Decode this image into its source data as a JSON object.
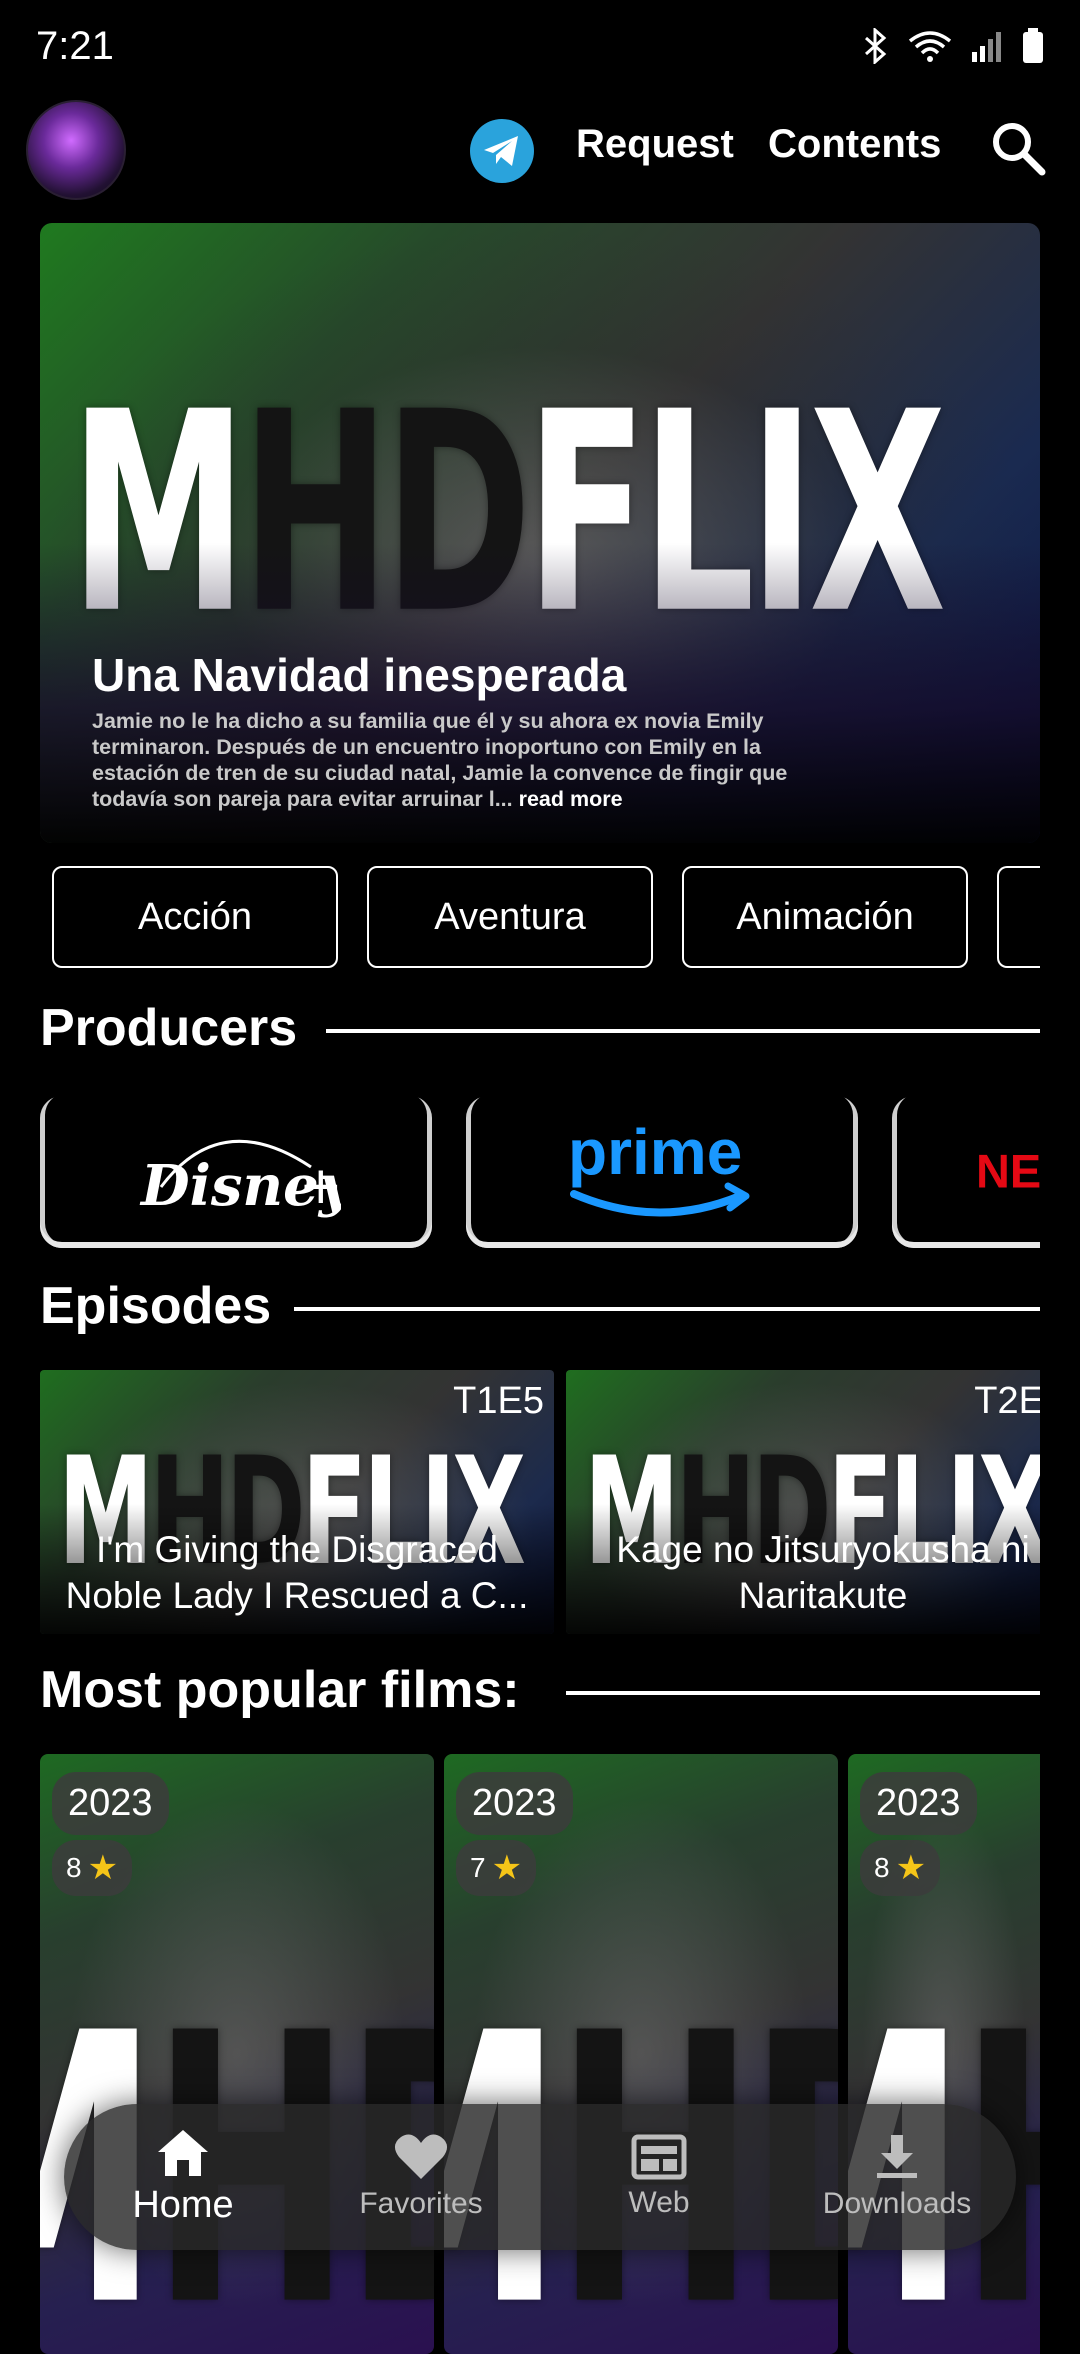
{
  "status": {
    "time": "7:21"
  },
  "header": {
    "request_label": "Request",
    "contents_label": "Contents"
  },
  "brand": {
    "logo_part1": "M",
    "logo_part2": "HD",
    "logo_part3": "FLIX"
  },
  "hero": {
    "title": "Una Navidad inesperada",
    "description": "Jamie no le ha dicho a su familia que él y su ahora ex novia Emily terminaron. Después de un encuentro inoportuno con Emily en la estación de tren de su ciudad natal, Jamie la convence de fingir que todavía son pareja para evitar arruinar l...",
    "read_more": "read more"
  },
  "genres": [
    "Acción",
    "Aventura",
    "Animación"
  ],
  "producers": {
    "title": "Producers"
  },
  "episodes": {
    "title": "Episodes",
    "items": [
      {
        "code": "T1E5",
        "title": "I'm Giving the Disgraced Noble Lady I Rescued a C..."
      },
      {
        "code": "T2E",
        "title": "Kage no Jitsuryokusha ni Naritakute"
      }
    ]
  },
  "films": {
    "title": "Most popular films:",
    "items": [
      {
        "year": "2023",
        "rating": "8"
      },
      {
        "year": "2023",
        "rating": "7"
      },
      {
        "year": "2023",
        "rating": "8"
      }
    ]
  },
  "nav": {
    "home": "Home",
    "favorites": "Favorites",
    "web": "Web",
    "downloads": "Downloads"
  },
  "colors": {
    "telegram": "#2aa3dc",
    "star": "#f5c518",
    "prime": "#1a98ff",
    "netflix": "#e50914"
  }
}
